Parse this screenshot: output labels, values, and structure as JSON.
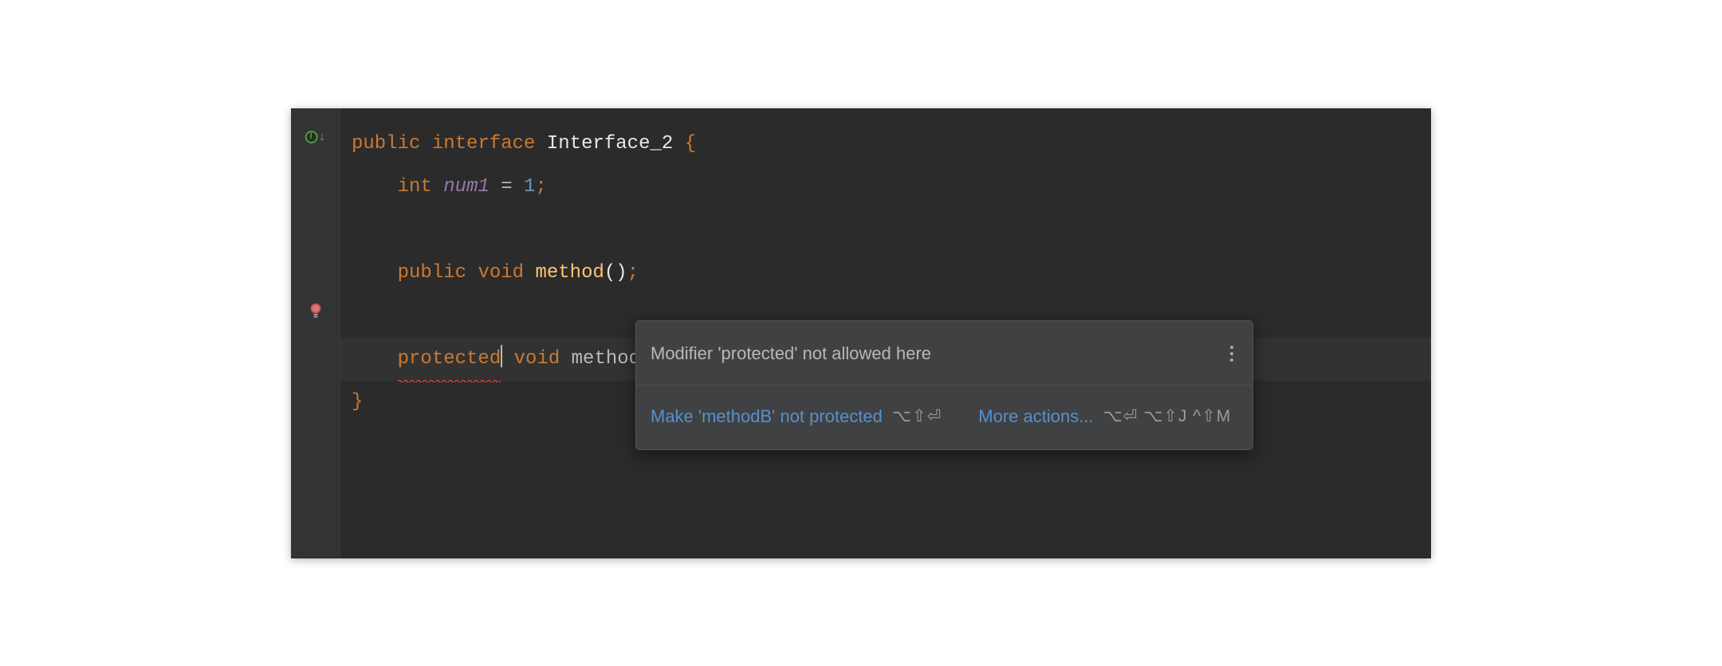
{
  "code": {
    "line1": {
      "kw_public": "public",
      "kw_interface": "interface",
      "class_name": "Interface_2",
      "brace_open": "{"
    },
    "line2": {
      "type_int": "int",
      "field_name": "num1",
      "equals": "=",
      "value": "1",
      "semi": ";"
    },
    "line4": {
      "kw_public": "public",
      "kw_void": "void",
      "method_name": "method",
      "parens": "()",
      "semi": ";"
    },
    "line6": {
      "kw_protected": "protected",
      "kw_void": "void",
      "method_name": "methodB",
      "parens": "()",
      "semi": ";"
    },
    "line7": {
      "brace_close": "}"
    }
  },
  "popup": {
    "message": "Modifier 'protected' not allowed here",
    "action1": {
      "label": "Make 'methodB' not protected",
      "shortcut": "⌥⇧⏎"
    },
    "action2": {
      "label": "More actions...",
      "shortcut": "⌥⏎ ⌥⇧J ^⇧M"
    }
  },
  "icons": {
    "implemented": "implemented-down-icon",
    "bulb": "error-intention-bulb-icon",
    "more": "more-vertical-icon"
  }
}
